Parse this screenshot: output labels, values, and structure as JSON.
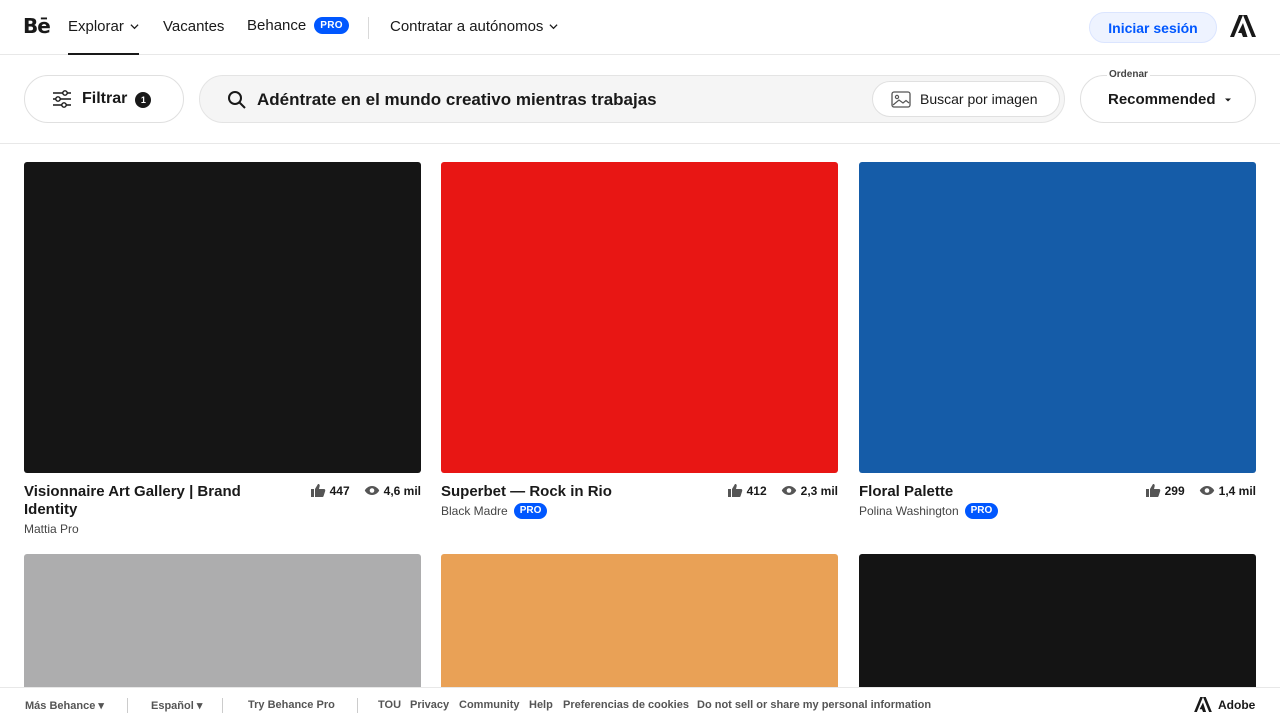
{
  "nav": {
    "logo": "Bē",
    "explore": "Explorar",
    "jobs": "Vacantes",
    "behance": "Behance",
    "pro_badge": "PRO",
    "hire": "Contratar a autónomos",
    "signin": "Iniciar sesión"
  },
  "toolbar": {
    "filter_label": "Filtrar",
    "filter_count": "1",
    "search_text": "Adéntrate en el mundo creativo mientras trabajas",
    "image_search": "Buscar por imagen",
    "sort_label": "Ordenar",
    "sort_value": "Recommended"
  },
  "projects": [
    {
      "title": "Visionnaire Art Gallery | Brand Identity",
      "owner": "Mattia Pro",
      "pro": "",
      "likes": "447",
      "views": "4,6 mil",
      "color": "#151515"
    },
    {
      "title": "Superbet — Rock in Rio",
      "owner": "Black Madre",
      "pro": "PRO",
      "likes": "412",
      "views": "2,3 mil",
      "color": "#e81614"
    },
    {
      "title": "Floral Palette",
      "owner": "Polina Washington",
      "pro": "PRO",
      "likes": "299",
      "views": "1,4 mil",
      "color": "#155ca8"
    },
    {
      "color": "#adadae"
    },
    {
      "color": "#e9a156"
    },
    {
      "color": "#141414"
    }
  ],
  "footer": {
    "more": "Más Behance",
    "language": "Español",
    "try_pro": "Try Behance Pro",
    "tou": "TOU",
    "privacy": "Privacy",
    "community": "Community",
    "help": "Help",
    "cookies": "Preferencias de cookies",
    "donotsell": "Do not sell or share my personal information",
    "adobe": "Adobe"
  }
}
